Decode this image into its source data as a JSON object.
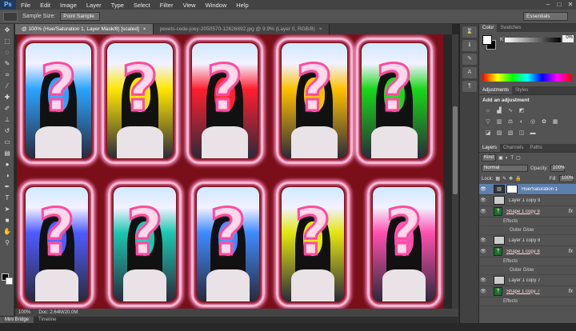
{
  "menubar": {
    "logo": "Ps",
    "items": [
      "File",
      "Edit",
      "Image",
      "Layer",
      "Type",
      "Select",
      "Filter",
      "View",
      "Window",
      "Help"
    ],
    "window_controls": [
      "–",
      "□",
      "✕"
    ]
  },
  "options": {
    "sample_size_label": "Sample Size:",
    "sample_size_value": "Point Sample",
    "workspace": "Essentials"
  },
  "tabs": [
    {
      "label": "@ 100% (Hue/Saturation 1, Layer Mask/8) [scaled]",
      "close": "×"
    },
    {
      "label": "pexels-cede-joey-2050570-12626892.jpg @ 9.9% (Layer 0, RGB/8)",
      "close": "×"
    }
  ],
  "toolbox": {
    "icons": [
      "move-icon",
      "marquee-icon",
      "lasso-icon",
      "quick-select-icon",
      "crop-icon",
      "eyedropper-icon",
      "healing-icon",
      "brush-icon",
      "stamp-icon",
      "history-brush-icon",
      "eraser-icon",
      "gradient-icon",
      "blur-icon",
      "dodge-icon",
      "pen-icon",
      "type-icon",
      "path-select-icon",
      "shape-icon",
      "hand-icon",
      "zoom-icon"
    ]
  },
  "canvas": {
    "background": "#7a0f1a",
    "row1_tints": [
      "#2aa3ff",
      "#ffe600",
      "#ff1f2e",
      "#ffbf00",
      "#18d818"
    ],
    "row2_tints": [
      "#4d5bff",
      "#1ac7b0",
      "#3d8bff",
      "#e3e60f",
      "#ff4fb0"
    ]
  },
  "status": {
    "zoom": "100%",
    "doc": "Doc: 2.64M/20.0M"
  },
  "bottom_tabs": [
    "Mini Bridge",
    "Timeline"
  ],
  "color_panel": {
    "tabs": [
      "Color",
      "Swatches"
    ],
    "k_label": "K",
    "k_value": "0",
    "k_unit": "%"
  },
  "adjustments": {
    "tabs": [
      "Adjustments",
      "Styles"
    ],
    "title": "Add an adjustment"
  },
  "layers_panel": {
    "tabs": [
      "Layers",
      "Channels",
      "Paths"
    ],
    "kind": "Kind",
    "blend_mode": "Normal",
    "opacity_label": "Opacity:",
    "opacity": "100%",
    "lock_label": "Lock:",
    "fill_label": "Fill:",
    "fill": "100%",
    "layers": [
      {
        "name": "Hue/Saturation 1",
        "type": "adjustment",
        "selected": true
      },
      {
        "name": "Layer 1 copy 9",
        "type": "pixel"
      },
      {
        "name": "Shape 1 copy 9",
        "type": "shape",
        "fx": "fx"
      },
      {
        "name": "Effects",
        "type": "sub"
      },
      {
        "name": "Outer Glow",
        "type": "subdeep"
      },
      {
        "name": "Layer 1 copy 8",
        "type": "pixel"
      },
      {
        "name": "Shape 1 copy 8",
        "type": "shape",
        "fx": "fx"
      },
      {
        "name": "Effects",
        "type": "sub"
      },
      {
        "name": "Outer Glow",
        "type": "subdeep"
      },
      {
        "name": "Layer 1 copy 7",
        "type": "pixel"
      },
      {
        "name": "Shape 1 copy 7",
        "type": "shape",
        "fx": "fx"
      },
      {
        "name": "Effects",
        "type": "sub"
      }
    ]
  }
}
